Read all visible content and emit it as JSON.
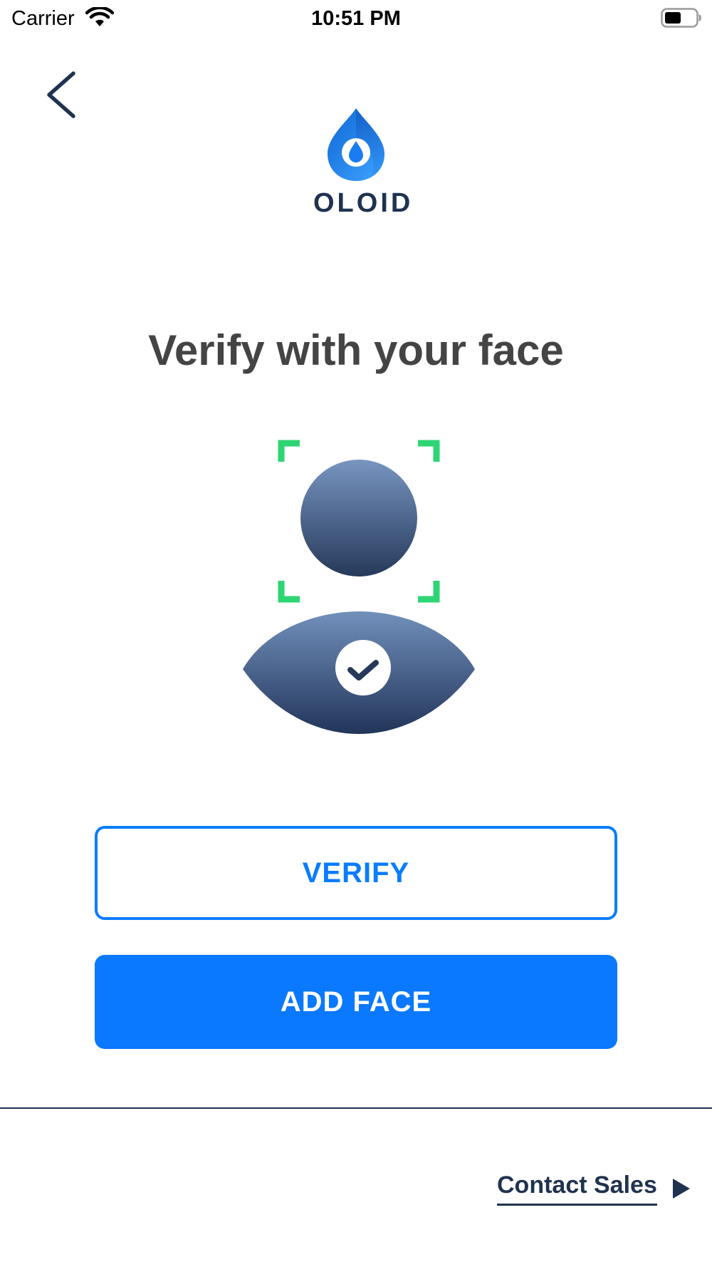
{
  "status_bar": {
    "carrier": "Carrier",
    "time": "10:51 PM"
  },
  "logo": {
    "text": "OLOID"
  },
  "page": {
    "title": "Verify with your face"
  },
  "buttons": {
    "verify_label": "VERIFY",
    "add_face_label": "ADD FACE"
  },
  "footer": {
    "contact_label": "Contact Sales"
  },
  "colors": {
    "accent": "#0a7cff",
    "navy": "#1f3350",
    "scan_corner": "#2ed573",
    "title": "#444444"
  },
  "icons": {
    "back": "chevron-left-icon",
    "wifi": "wifi-icon",
    "battery": "battery-icon",
    "checkmark": "checkmark-icon",
    "contact_arrow": "play-arrow-icon"
  }
}
